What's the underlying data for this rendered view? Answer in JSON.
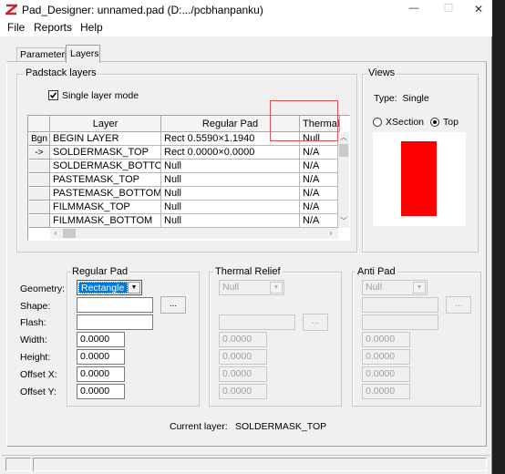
{
  "window": {
    "title": "Pad_Designer: unnamed.pad (D:.../pcbhanpanku)"
  },
  "titlebar": {
    "min_glyph": "—",
    "max_glyph": "☐",
    "close_glyph": "✕"
  },
  "menu": [
    "File",
    "Reports",
    "Help"
  ],
  "tabs": [
    {
      "label": "Parameters"
    },
    {
      "label": "Layers"
    }
  ],
  "padstack": {
    "group_label": "Padstack layers",
    "single_layer_label": "Single layer mode",
    "single_layer_checked": true,
    "columns": [
      "Layer",
      "Regular Pad",
      "Thermal F"
    ],
    "rows": [
      {
        "hdr": "Bgn",
        "layer": "BEGIN LAYER",
        "pad": "Rect 0.5590×1.1940",
        "thermal": "Null"
      },
      {
        "hdr": "->",
        "layer": "SOLDERMASK_TOP",
        "pad": "Rect 0.0000×0.0000",
        "thermal": "N/A"
      },
      {
        "hdr": "",
        "layer": "SOLDERMASK_BOTTOM",
        "pad": "Null",
        "thermal": "N/A"
      },
      {
        "hdr": "",
        "layer": "PASTEMASK_TOP",
        "pad": "Null",
        "thermal": "N/A"
      },
      {
        "hdr": "",
        "layer": "PASTEMASK_BOTTOM",
        "pad": "Null",
        "thermal": "N/A"
      },
      {
        "hdr": "",
        "layer": "FILMMASK_TOP",
        "pad": "Null",
        "thermal": "N/A"
      },
      {
        "hdr": "",
        "layer": "FILMMASK_BOTTOM",
        "pad": "Null",
        "thermal": "N/A"
      }
    ]
  },
  "views": {
    "group_label": "Views",
    "type_text": "Type:  Single",
    "xsection_label": "XSection",
    "top_label": "Top",
    "selected": "Top",
    "pad_color": "#ff0000"
  },
  "regular_pad": {
    "group_label": "Regular Pad",
    "geometry": "Rectangle",
    "shape": "",
    "flash": "",
    "width": "0.0000",
    "height": "0.0000",
    "offset_x": "0.0000",
    "offset_y": "0.0000",
    "browse_label": "..."
  },
  "labels": {
    "geometry": "Geometry:",
    "shape": "Shape:",
    "flash": "Flash:",
    "width": "Width:",
    "height": "Height:",
    "offset_x": "Offset X:",
    "offset_y": "Offset Y:"
  },
  "thermal_relief": {
    "group_label": "Thermal Relief",
    "geometry": "Null",
    "width": "0.0000",
    "height": "0.0000",
    "offset_x": "0.0000",
    "offset_y": "0.0000",
    "browse_label": "..."
  },
  "anti_pad": {
    "group_label": "Anti Pad",
    "geometry": "Null",
    "width": "0.0000",
    "height": "0.0000",
    "offset_x": "0.0000",
    "offset_y": "0.0000",
    "browse_label": "..."
  },
  "current_layer": {
    "label": "Current layer:",
    "value": "SOLDERMASK_TOP"
  },
  "accent": "#0078d7",
  "highlight_box_color": "#e05050"
}
